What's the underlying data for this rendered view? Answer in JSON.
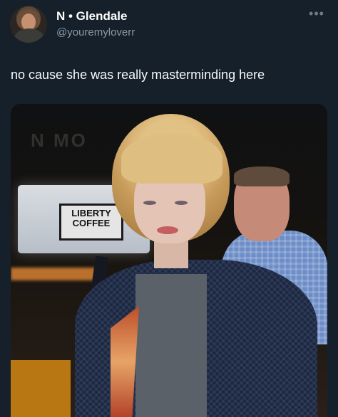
{
  "author": {
    "name": "N • Glendale",
    "handle": "@youremyloverr"
  },
  "more_label": "•••",
  "tweet": {
    "text": "no cause she was really masterminding here"
  },
  "media": {
    "sign_text": "LIBERTY COFFEE",
    "building_text": "N  MO"
  },
  "colors": {
    "background": "#15202b",
    "primary_text": "#e7e9ea",
    "secondary_text": "#8b98a5"
  }
}
